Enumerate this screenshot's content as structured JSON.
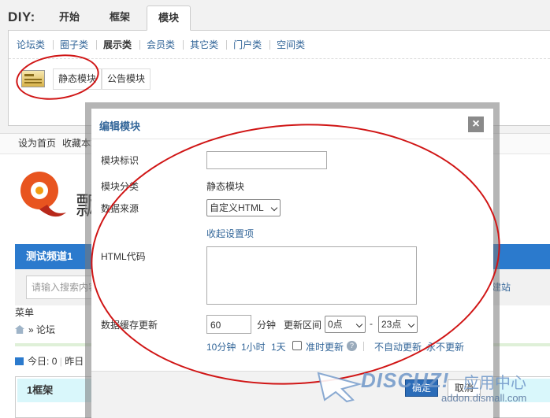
{
  "diy": {
    "label": "DIY:",
    "tabs": [
      "开始",
      "框架",
      "模块"
    ],
    "categories": [
      "论坛类",
      "圈子类",
      "展示类",
      "会员类",
      "其它类",
      "门户类",
      "空间类"
    ],
    "blocks": [
      "静态模块",
      "公告模块"
    ]
  },
  "page": {
    "top_links": [
      "设为首页",
      "收藏本站"
    ],
    "logo_text": "飘",
    "nav_title": "测试频道1",
    "search_placeholder": "请输入搜索内容",
    "build_link": "建站",
    "menu_label": "菜单",
    "breadcrumb": [
      "»",
      "论坛"
    ],
    "stats_today_label": "今日:",
    "stats_today_value": "0",
    "stats_yesterday_label": "昨日",
    "frame_title": "1框架"
  },
  "modal": {
    "title": "编辑模块",
    "close_label": "×",
    "id_label": "模块标识",
    "id_value": "",
    "category_label": "模块分类",
    "category_value": "静态模块",
    "source_label": "数据来源",
    "source_value": "自定义HTML",
    "collapse_link": "收起设置项",
    "html_label": "HTML代码",
    "html_value": "",
    "cache_label": "数据缓存更新",
    "cache_value": "60",
    "cache_unit": "分钟",
    "range_label": "更新区间",
    "range_start": "0点",
    "range_dash": "-",
    "range_end": "23点",
    "quick_options": [
      "10分钟",
      "1小时",
      "1天"
    ],
    "realtime_label": "准时更新",
    "no_auto": "不自动更新",
    "never": "永不更新",
    "ok_label": "确定",
    "cancel_label": "取消"
  },
  "watermark": {
    "brand": "DISCUZ!",
    "cn": "应用中心",
    "url": "addon.dismall.com"
  }
}
